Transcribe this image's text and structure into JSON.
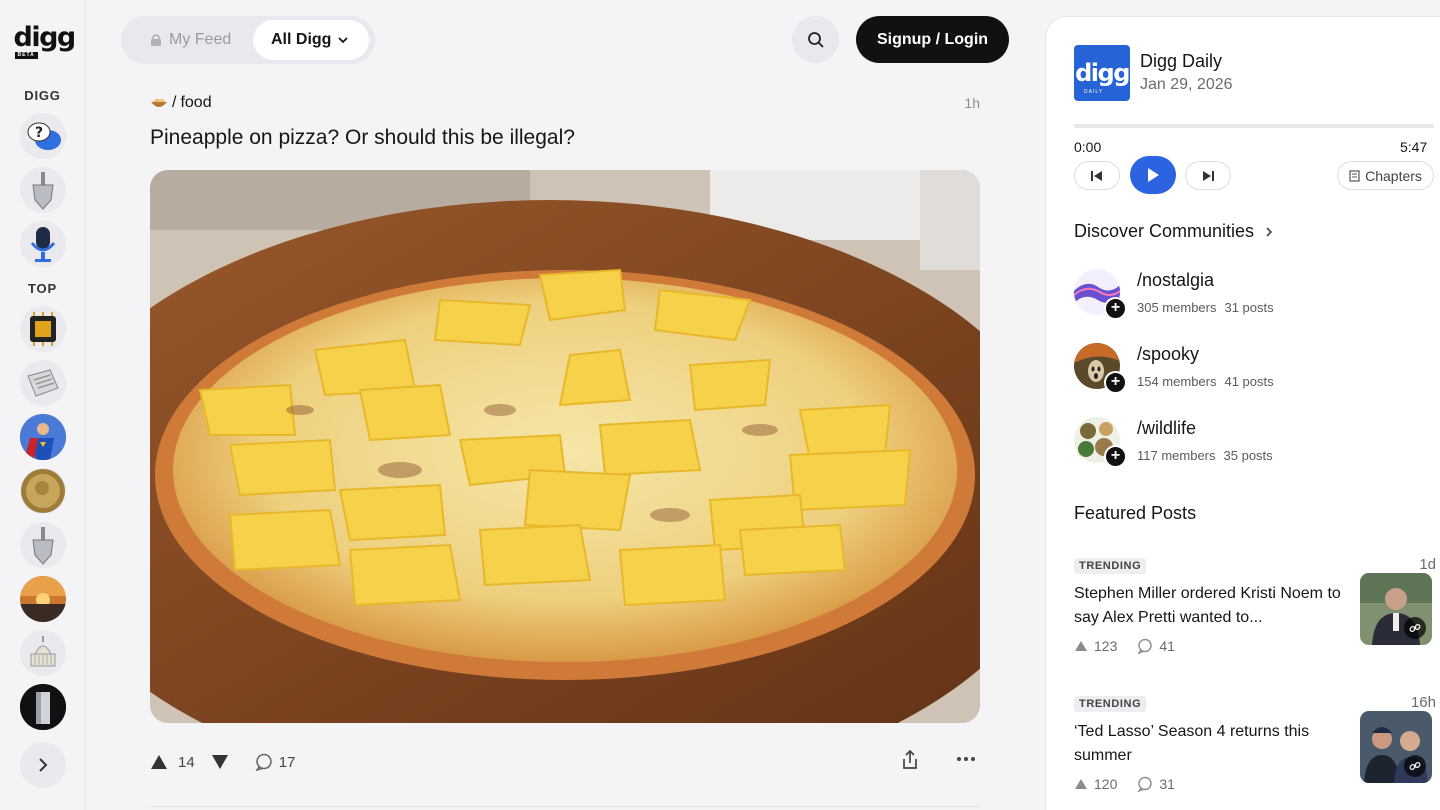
{
  "brand": {
    "logo_text": "digg",
    "logo_badge": "BETA"
  },
  "rail": {
    "section_digg": "DIGG",
    "section_top": "TOP",
    "digg_items": [
      {
        "icon": "question-chat-icon"
      },
      {
        "icon": "shovel-icon"
      },
      {
        "icon": "microphone-icon"
      }
    ],
    "top_items": [
      {
        "icon": "chip-icon"
      },
      {
        "icon": "newspaper-icon"
      },
      {
        "icon": "superhero-icon"
      },
      {
        "icon": "coin-icon"
      },
      {
        "icon": "shovel-icon"
      },
      {
        "icon": "sunset-icon"
      },
      {
        "icon": "capitol-icon"
      },
      {
        "icon": "monolith-icon"
      }
    ]
  },
  "topbar": {
    "my_feed": "My Feed",
    "all_digg": "All Digg",
    "login": "Signup / Login"
  },
  "post": {
    "community": "food",
    "time": "1h",
    "title": "Pineapple on pizza? Or should this be illegal?",
    "upvotes": "14",
    "comments": "17"
  },
  "panel": {
    "podcast": {
      "title": "Digg Daily",
      "date": "Jan 29, 2026",
      "art_text": "digg",
      "art_sub": "DAILY",
      "time_start": "0:00",
      "time_end": "5:47",
      "progress": 0,
      "chapters": "Chapters"
    },
    "discover_title": "Discover Communities",
    "communities": [
      {
        "name": "nostalgia",
        "members": "305 members",
        "posts": "31 posts"
      },
      {
        "name": "spooky",
        "members": "154 members",
        "posts": "41 posts"
      },
      {
        "name": "wildlife",
        "members": "117 members",
        "posts": "35 posts"
      }
    ],
    "featured_title": "Featured Posts",
    "featured": [
      {
        "badge": "TRENDING",
        "age": "1d",
        "headline": "Stephen Miller ordered Kristi Noem to say Alex Pretti wanted to...",
        "votes": "123",
        "comments": "41"
      },
      {
        "badge": "TRENDING",
        "age": "16h",
        "headline": "‘Ted Lasso’ Season 4 returns this summer",
        "votes": "120",
        "comments": "31"
      }
    ]
  },
  "colors": {
    "accent": "#2c63e0",
    "dark": "#111111",
    "bg": "#f4f4f6"
  }
}
